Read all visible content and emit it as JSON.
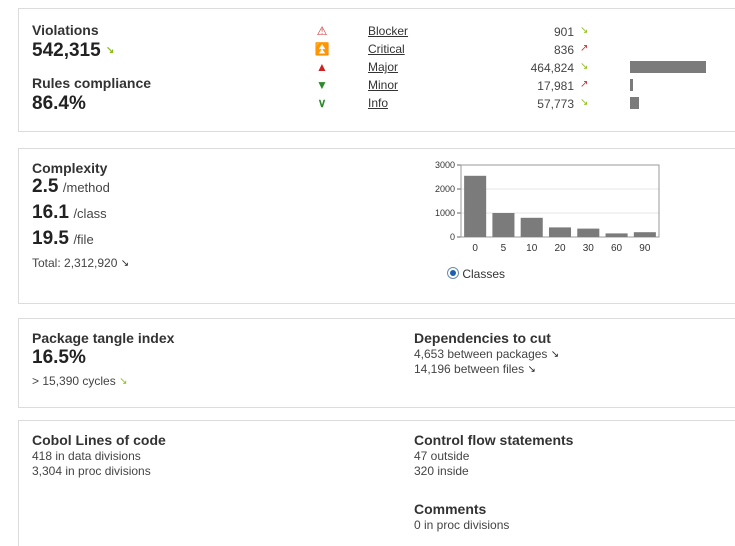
{
  "violations": {
    "label": "Violations",
    "value": "542,315",
    "compliance_label": "Rules compliance",
    "compliance_value": "86.4%",
    "severities": [
      {
        "name": "Blocker",
        "count": "901",
        "trend": "good",
        "bar": 0
      },
      {
        "name": "Critical",
        "count": "836",
        "trend": "bad",
        "bar": 0
      },
      {
        "name": "Major",
        "count": "464,824",
        "trend": "good",
        "bar": 1.0
      },
      {
        "name": "Minor",
        "count": "17,981",
        "trend": "bad",
        "bar": 0.039
      },
      {
        "name": "Info",
        "count": "57,773",
        "trend": "good",
        "bar": 0.124
      }
    ]
  },
  "complexity": {
    "label": "Complexity",
    "per_method_value": "2.5",
    "per_method_unit": "/method",
    "per_class_value": "16.1",
    "per_class_unit": "/class",
    "per_file_value": "19.5",
    "per_file_unit": "/file",
    "total": "Total: 2,312,920",
    "radio_label": "Classes"
  },
  "chart_data": {
    "type": "bar",
    "categories": [
      "0",
      "5",
      "10",
      "20",
      "30",
      "60",
      "90"
    ],
    "values": [
      2550,
      1000,
      800,
      400,
      350,
      150,
      200
    ],
    "ylim": [
      0,
      3000
    ],
    "yticks": [
      "0",
      "1000",
      "2000",
      "3000"
    ],
    "title": "",
    "xlabel": "",
    "ylabel": "",
    "bar_color": "#7b7b7b",
    "grid": true
  },
  "tangle": {
    "label": "Package tangle index",
    "value": "16.5%",
    "cycles": "> 15,390 cycles",
    "deps_label": "Dependencies to cut",
    "deps_packages": "4,653 between packages",
    "deps_files": "14,196 between files"
  },
  "cobol": {
    "loc_label": "Cobol Lines of code",
    "data_divisions": "418 in data divisions",
    "proc_divisions": "3,304 in proc divisions",
    "cf_label": "Control flow statements",
    "cf_outside": "47 outside",
    "cf_inside": "320 inside",
    "comments_label": "Comments",
    "comments_value": "0 in proc divisions"
  },
  "colors": {
    "good": "#8cbc1c",
    "bad": "#d42828",
    "bar": "#7b7b7b",
    "border": "#dcdcdc"
  }
}
